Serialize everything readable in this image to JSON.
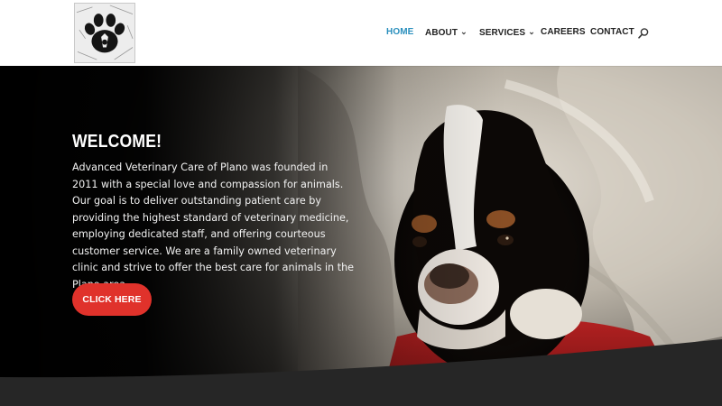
{
  "nav": {
    "items": [
      {
        "label": "HOME",
        "active": true,
        "has_dropdown": false
      },
      {
        "label": "ABOUT",
        "active": false,
        "has_dropdown": true
      },
      {
        "label": "SERVICES",
        "active": false,
        "has_dropdown": true
      },
      {
        "label": "CAREERS",
        "active": false,
        "has_dropdown": false
      },
      {
        "label": "CONTACT",
        "active": false,
        "has_dropdown": false
      }
    ],
    "search_icon": "search-icon",
    "active_color": "#2a8fbd"
  },
  "logo": {
    "icon": "paw-print-icon"
  },
  "hero": {
    "title": "WELCOME!",
    "text": "Advanced Veterinary Care of Plano was founded in 2011 with a special love and compassion for animals. Our goal is to deliver outstanding patient care by providing the highest standard of veterinary medicine, employing dedicated staff, and offering courteous customer service. We are a family owned veterinary clinic and strive to offer the best care for animals in the Plano area.",
    "cta_label": "CLICK HERE",
    "cta_color": "#e0322b",
    "image": "dog-wrapped-in-blanket-photo"
  },
  "colors": {
    "section_band": "#262626",
    "hero_overlay": "#000000"
  }
}
